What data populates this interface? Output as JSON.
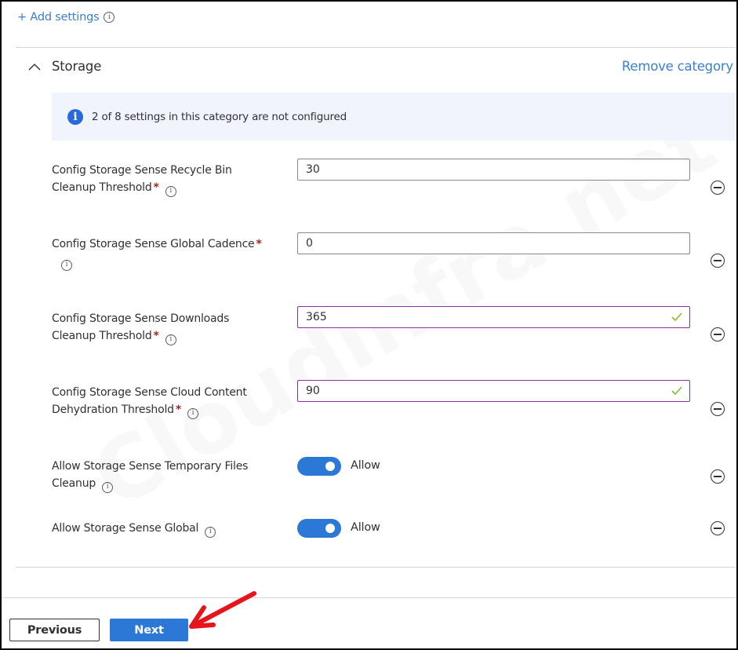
{
  "header": {
    "add_settings_label": "+ Add settings",
    "add_settings_info_icon": "info-icon"
  },
  "category": {
    "title": "Storage",
    "expanded": true,
    "collapse_icon": "chevron-up-icon",
    "remove_label": "Remove category"
  },
  "banner": {
    "icon": "info-filled-icon",
    "text": "2 of 8 settings in this category are not configured",
    "not_configured": 2,
    "total": 8
  },
  "settings": [
    {
      "label_line1": "Config Storage Sense Recycle Bin",
      "label_line2": "Cleanup Threshold",
      "required": true,
      "type": "text",
      "value": "30",
      "valid": false
    },
    {
      "label_line1": "Config Storage Sense Global Cadence",
      "label_line2": "",
      "required": true,
      "type": "text",
      "value": "0",
      "valid": false
    },
    {
      "label_line1": "Config Storage Sense Downloads",
      "label_line2": "Cleanup Threshold",
      "required": true,
      "type": "text",
      "value": "365",
      "valid": true
    },
    {
      "label_line1": "Config Storage Sense Cloud Content",
      "label_line2": "Dehydration Threshold",
      "required": true,
      "type": "text",
      "value": "90",
      "valid": true
    },
    {
      "label_line1": "Allow Storage Sense Temporary Files",
      "label_line2": "Cleanup",
      "required": false,
      "type": "toggle",
      "on": true,
      "value": "Allow"
    },
    {
      "label_line1": "Allow Storage Sense Global",
      "label_line2": "",
      "required": false,
      "type": "toggle",
      "on": true,
      "value": "Allow"
    }
  ],
  "required_marker": "*",
  "info_glyph": "i",
  "footer": {
    "previous_label": "Previous",
    "next_label": "Next"
  },
  "annotation": {
    "icon": "red-arrow-icon",
    "color": "#e8141b",
    "points_to": "Next"
  },
  "watermark": "Cloudinfra.net",
  "colors": {
    "link": "#3b7fd1",
    "primary": "#2b78d6",
    "banner_bg": "#f0f5fd",
    "valid_border": "#8a2fa8",
    "valid_check": "#6bb700",
    "required": "#a4262c"
  }
}
